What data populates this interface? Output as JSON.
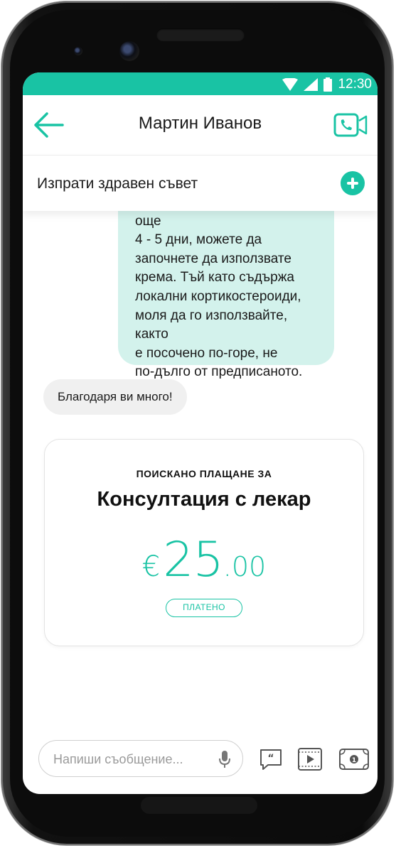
{
  "status_bar": {
    "time": "12:30"
  },
  "header": {
    "title": "Мартин Иванов"
  },
  "advice_bar": {
    "label": "Изпрати здравен съвет"
  },
  "messages": {
    "outgoing_lines": [
      "ако обривът продължава още",
      "4 - 5 дни, можете да",
      "започнете да използвате",
      "крема. Тъй като съдържа",
      "локални кортикостероиди,",
      "моля да го използвайте, както",
      "е посочено по-горе, не",
      "по-дълго от предписаното."
    ],
    "incoming": "Благодаря ви много!"
  },
  "payment_card": {
    "kicker": "ПОИСКАНО ПЛАЩАНЕ ЗА",
    "title": "Консултация с лекар",
    "currency": "€",
    "amount": "25",
    "cents": ".00",
    "status": "ПЛАТЕНО"
  },
  "composer": {
    "placeholder": "Напиши съобщение..."
  },
  "icons": [
    "back-arrow-icon",
    "video-call-icon",
    "plus-icon",
    "microphone-icon",
    "quote-icon",
    "video-file-icon",
    "payment-icon",
    "wifi-icon",
    "signal-icon",
    "battery-icon"
  ],
  "colors": {
    "accent": "#19c3a4",
    "outgoing_bubble": "#d3f2ec",
    "incoming_bubble": "#f0f0f0"
  }
}
